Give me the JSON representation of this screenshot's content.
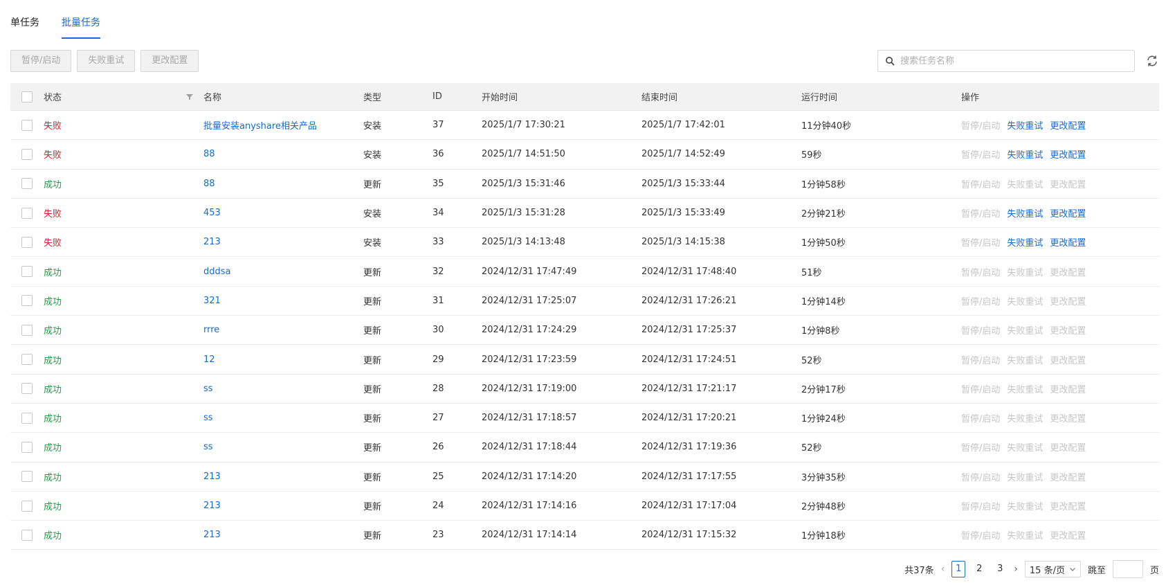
{
  "tabs": [
    {
      "label": "单任务",
      "active": false
    },
    {
      "label": "批量任务",
      "active": true
    }
  ],
  "toolbar": {
    "pause_label": "暂停/启动",
    "retry_label": "失败重试",
    "config_label": "更改配置"
  },
  "search": {
    "placeholder": "搜索任务名称",
    "icon": "search-icon"
  },
  "refresh_icon": "refresh-icon",
  "columns": {
    "status": "状态",
    "name": "名称",
    "type": "类型",
    "id": "ID",
    "start": "开始时间",
    "end": "结束时间",
    "duration": "运行时间",
    "ops": "操作"
  },
  "colors": {
    "accent": "#1769d4",
    "fail": "#e0202a",
    "success": "#2a9a4c",
    "disabled": "#c6c6c6"
  },
  "ops_labels": [
    "暂停/启动",
    "失败重试",
    "更改配置"
  ],
  "rows": [
    {
      "status": "失败",
      "status_kind": "fail",
      "name": "批量安装anyshare相关产品",
      "type": "安装",
      "id": "37",
      "start": "2025/1/7 17:30:21",
      "end": "2025/1/7 17:42:01",
      "duration": "11分钟40秒",
      "ops_enabled": [
        false,
        true,
        true
      ]
    },
    {
      "status": "失败",
      "status_kind": "fail",
      "name": "88",
      "type": "安装",
      "id": "36",
      "start": "2025/1/7 14:51:50",
      "end": "2025/1/7 14:52:49",
      "duration": "59秒",
      "ops_enabled": [
        false,
        true,
        true
      ]
    },
    {
      "status": "成功",
      "status_kind": "ok",
      "name": "88",
      "type": "更新",
      "id": "35",
      "start": "2025/1/3 15:31:46",
      "end": "2025/1/3 15:33:44",
      "duration": "1分钟58秒",
      "ops_enabled": [
        false,
        false,
        false
      ]
    },
    {
      "status": "失败",
      "status_kind": "fail",
      "name": "453",
      "type": "安装",
      "id": "34",
      "start": "2025/1/3 15:31:28",
      "end": "2025/1/3 15:33:49",
      "duration": "2分钟21秒",
      "ops_enabled": [
        false,
        true,
        true
      ]
    },
    {
      "status": "失败",
      "status_kind": "fail",
      "name": "213",
      "type": "安装",
      "id": "33",
      "start": "2025/1/3 14:13:48",
      "end": "2025/1/3 14:15:38",
      "duration": "1分钟50秒",
      "ops_enabled": [
        false,
        true,
        true
      ]
    },
    {
      "status": "成功",
      "status_kind": "ok",
      "name": "dddsa",
      "type": "更新",
      "id": "32",
      "start": "2024/12/31 17:47:49",
      "end": "2024/12/31 17:48:40",
      "duration": "51秒",
      "ops_enabled": [
        false,
        false,
        false
      ]
    },
    {
      "status": "成功",
      "status_kind": "ok",
      "name": "321",
      "type": "更新",
      "id": "31",
      "start": "2024/12/31 17:25:07",
      "end": "2024/12/31 17:26:21",
      "duration": "1分钟14秒",
      "ops_enabled": [
        false,
        false,
        false
      ]
    },
    {
      "status": "成功",
      "status_kind": "ok",
      "name": "rrre",
      "type": "更新",
      "id": "30",
      "start": "2024/12/31 17:24:29",
      "end": "2024/12/31 17:25:37",
      "duration": "1分钟8秒",
      "ops_enabled": [
        false,
        false,
        false
      ]
    },
    {
      "status": "成功",
      "status_kind": "ok",
      "name": "12",
      "type": "更新",
      "id": "29",
      "start": "2024/12/31 17:23:59",
      "end": "2024/12/31 17:24:51",
      "duration": "52秒",
      "ops_enabled": [
        false,
        false,
        false
      ]
    },
    {
      "status": "成功",
      "status_kind": "ok",
      "name": "ss",
      "type": "更新",
      "id": "28",
      "start": "2024/12/31 17:19:00",
      "end": "2024/12/31 17:21:17",
      "duration": "2分钟17秒",
      "ops_enabled": [
        false,
        false,
        false
      ]
    },
    {
      "status": "成功",
      "status_kind": "ok",
      "name": "ss",
      "type": "更新",
      "id": "27",
      "start": "2024/12/31 17:18:57",
      "end": "2024/12/31 17:20:21",
      "duration": "1分钟24秒",
      "ops_enabled": [
        false,
        false,
        false
      ]
    },
    {
      "status": "成功",
      "status_kind": "ok",
      "name": "ss",
      "type": "更新",
      "id": "26",
      "start": "2024/12/31 17:18:44",
      "end": "2024/12/31 17:19:36",
      "duration": "52秒",
      "ops_enabled": [
        false,
        false,
        false
      ]
    },
    {
      "status": "成功",
      "status_kind": "ok",
      "name": "213",
      "type": "更新",
      "id": "25",
      "start": "2024/12/31 17:14:20",
      "end": "2024/12/31 17:17:55",
      "duration": "3分钟35秒",
      "ops_enabled": [
        false,
        false,
        false
      ]
    },
    {
      "status": "成功",
      "status_kind": "ok",
      "name": "213",
      "type": "更新",
      "id": "24",
      "start": "2024/12/31 17:14:16",
      "end": "2024/12/31 17:17:04",
      "duration": "2分钟48秒",
      "ops_enabled": [
        false,
        false,
        false
      ]
    },
    {
      "status": "成功",
      "status_kind": "ok",
      "name": "213",
      "type": "更新",
      "id": "23",
      "start": "2024/12/31 17:14:14",
      "end": "2024/12/31 17:15:32",
      "duration": "1分钟18秒",
      "ops_enabled": [
        false,
        false,
        false
      ]
    }
  ],
  "pagination": {
    "total_label": "共37条",
    "pages": [
      "1",
      "2",
      "3"
    ],
    "current": "1",
    "page_size_label": "15 条/页",
    "jump_label": "跳至",
    "page_unit": "页"
  }
}
